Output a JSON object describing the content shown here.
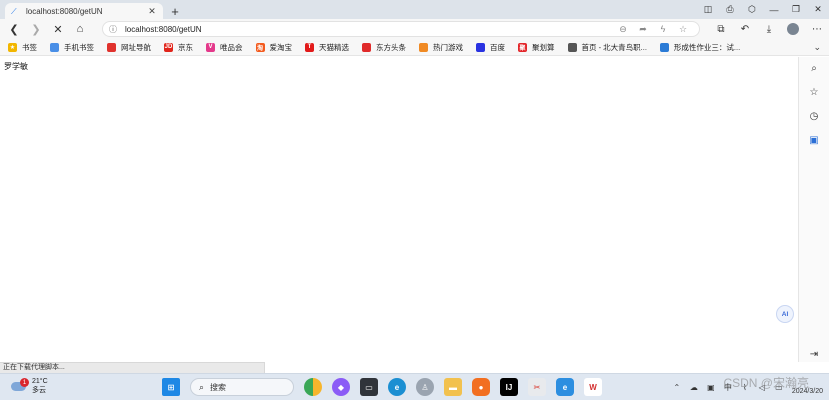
{
  "tab": {
    "title": "localhost:8080/getUN",
    "close": "✕",
    "new_tab": "+"
  },
  "window_controls": {
    "minimize": "—",
    "maximize": "❐",
    "close": "✕"
  },
  "address_bar": {
    "url": "localhost:8080/getUN",
    "info_icon": "ⓘ"
  },
  "bookmarks": [
    {
      "label": "书签",
      "color": "#f2b600",
      "glyph": "★"
    },
    {
      "label": "手机书签",
      "color": "#4a8fe7",
      "glyph": ""
    },
    {
      "label": "网址导航",
      "color": "#e0322d",
      "glyph": ""
    },
    {
      "label": "京东",
      "color": "#e1251b",
      "glyph": "JD"
    },
    {
      "label": "唯品会",
      "color": "#e4398b",
      "glyph": "V"
    },
    {
      "label": "爱淘宝",
      "color": "#f35a1e",
      "glyph": "淘"
    },
    {
      "label": "天猫精选",
      "color": "#e21a1a",
      "glyph": "T"
    },
    {
      "label": "东方头条",
      "color": "#e02b2b",
      "glyph": ""
    },
    {
      "label": "热门游戏",
      "color": "#f08a24",
      "glyph": ""
    },
    {
      "label": "百度",
      "color": "#2932e1",
      "glyph": ""
    },
    {
      "label": "聚划算",
      "color": "#e3262a",
      "glyph": "聚"
    },
    {
      "label": "首页 - 北大青鸟职...",
      "color": "#555555",
      "glyph": ""
    },
    {
      "label": "形成性作业三：试...",
      "color": "#2b7bd6",
      "glyph": ""
    }
  ],
  "content": {
    "text": "罗学敏",
    "ai_label": "AI"
  },
  "status_bar": {
    "text": "正在下载代理脚本..."
  },
  "taskbar": {
    "weather_temp": "21°C",
    "weather_desc": "多云",
    "weather_badge": "1",
    "search_label": "搜索",
    "clock_date": "2024/3/20"
  },
  "watermark": "CSDN @宋瀚亮"
}
